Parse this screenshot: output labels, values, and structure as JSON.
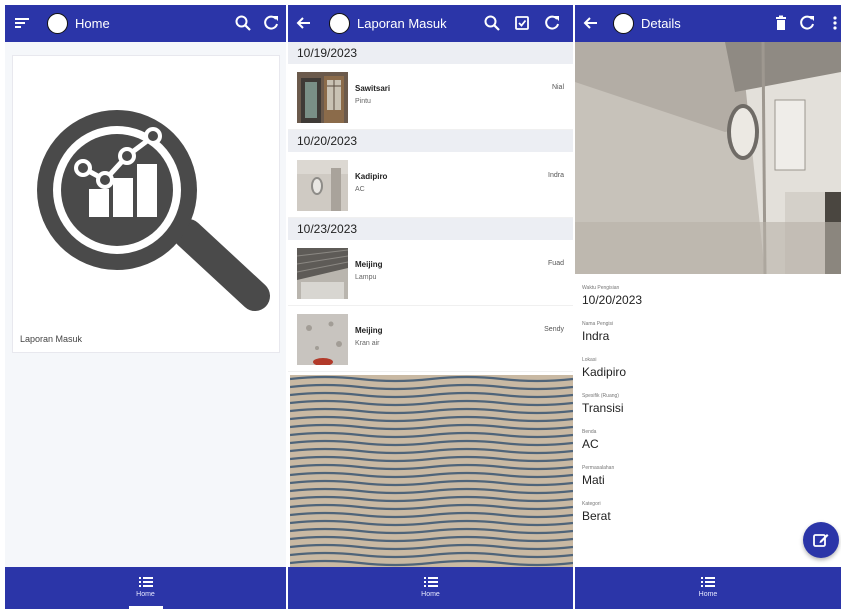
{
  "screen1": {
    "title": "Home",
    "card": {
      "label": "Laporan Masuk"
    },
    "bottom_nav": {
      "label": "Home"
    }
  },
  "screen2": {
    "title": "Laporan Masuk",
    "groups": [
      {
        "date": "10/19/2023",
        "items": [
          {
            "location": "Sawitsari",
            "object": "Pintu",
            "reporter": "Nial"
          }
        ]
      },
      {
        "date": "10/20/2023",
        "items": [
          {
            "location": "Kadipiro",
            "object": "AC",
            "reporter": "Indra"
          }
        ]
      },
      {
        "date": "10/23/2023",
        "items": [
          {
            "location": "Meijing",
            "object": "Lampu",
            "reporter": "Fuad"
          },
          {
            "location": "Meijing",
            "object": "Kran air",
            "reporter": "Sendy"
          }
        ]
      }
    ],
    "bottom_nav": {
      "label": "Home"
    }
  },
  "screen3": {
    "title": "Details",
    "fields": [
      {
        "label": "Waktu Pengisian",
        "value": "10/20/2023"
      },
      {
        "label": "Nama Pengisi",
        "value": "Indra"
      },
      {
        "label": "Lokasi",
        "value": "Kadipiro"
      },
      {
        "label": "Spesifik (Ruang)",
        "value": "Transisi"
      },
      {
        "label": "Benda",
        "value": "AC"
      },
      {
        "label": "Permasalahan",
        "value": "Mati"
      },
      {
        "label": "Kategori",
        "value": "Berat"
      }
    ],
    "bottom_nav": {
      "label": "Home"
    }
  },
  "colors": {
    "primary": "#2b35a8",
    "header_bg": "#eceef3",
    "icon_gray": "#555555"
  },
  "icons": [
    "sort-icon",
    "search-icon",
    "refresh-icon",
    "back-icon",
    "checkbox-icon",
    "delete-icon",
    "more-icon",
    "list-icon",
    "edit-icon",
    "analytics-search-icon"
  ]
}
